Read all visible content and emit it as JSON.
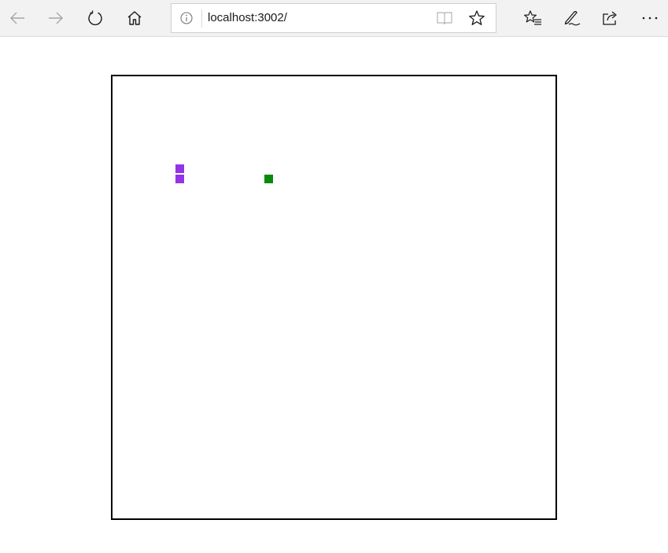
{
  "browser": {
    "url": "localhost:3002/",
    "icons": {
      "back": "back-arrow-icon",
      "forward": "forward-arrow-icon",
      "refresh": "refresh-icon",
      "home": "home-icon",
      "info": "info-icon",
      "reading_view": "reading-view-icon",
      "favorite": "star-icon",
      "favorites_list": "favorites-list-icon",
      "notes": "pen-icon",
      "share": "share-icon",
      "more": "more-icon"
    }
  },
  "game": {
    "snake_color": "#9334e6",
    "food_color": "#0a8a0a",
    "snake_segments": 2,
    "food_items": 1
  }
}
